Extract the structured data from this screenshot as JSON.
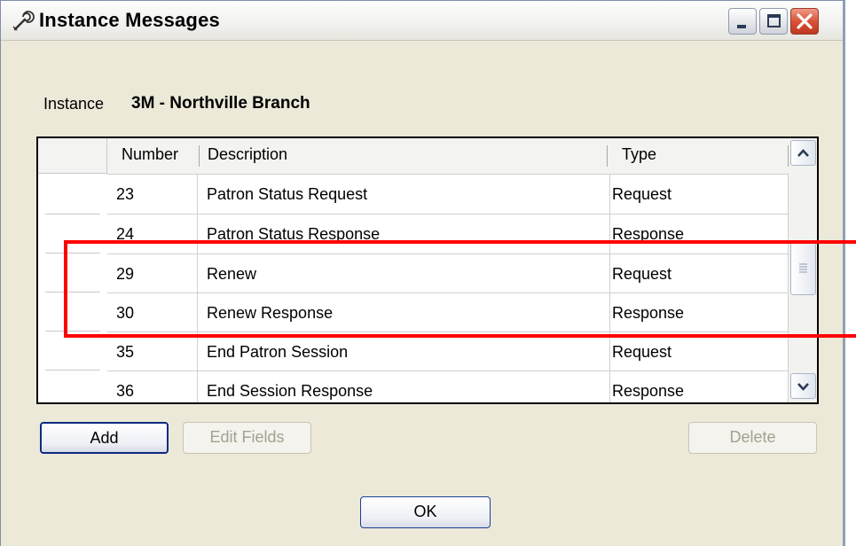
{
  "window": {
    "title": "Instance Messages",
    "icon": "wrench-icon"
  },
  "instance": {
    "label": "Instance",
    "value": "3M - Northville Branch"
  },
  "list": {
    "columns": [
      "Number",
      "Description",
      "Type"
    ],
    "rows": [
      {
        "number": "23",
        "description": "Patron Status Request",
        "type": "Request"
      },
      {
        "number": "24",
        "description": "Patron Status Response",
        "type": "Response"
      },
      {
        "number": "29",
        "description": "Renew",
        "type": "Request"
      },
      {
        "number": "30",
        "description": "Renew Response",
        "type": "Response"
      },
      {
        "number": "35",
        "description": "End Patron Session",
        "type": "Request"
      },
      {
        "number": "36",
        "description": "End Session Response",
        "type": "Response"
      }
    ]
  },
  "buttons": {
    "add": "Add",
    "edit_fields": "Edit Fields",
    "delete": "Delete",
    "ok": "OK"
  },
  "colors": {
    "highlight": "#ff0000",
    "close_button": "#d85438"
  }
}
